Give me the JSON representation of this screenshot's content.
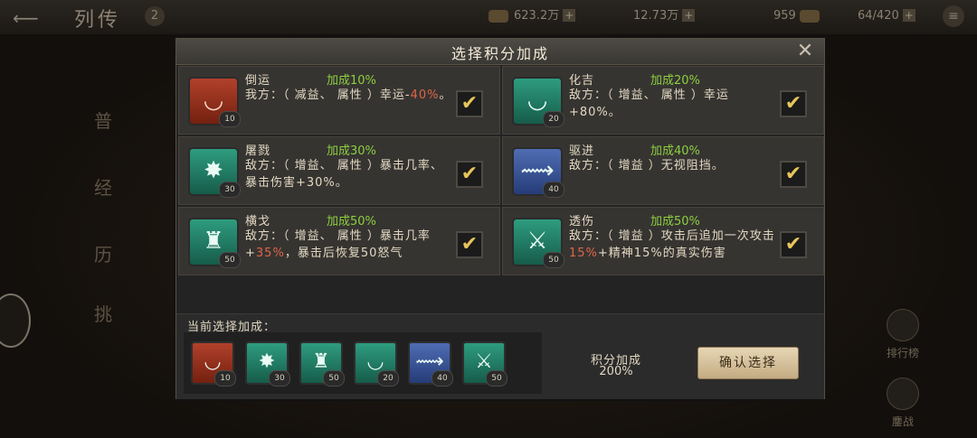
{
  "topbar": {
    "back_icon": "back-arrow",
    "page_name": "列传",
    "page_num": "2",
    "resources": [
      {
        "icon": "gold-icon",
        "value": "623.2万"
      },
      {
        "icon": "silver-icon",
        "value": "12.73万"
      },
      {
        "icon": "gem-icon",
        "value": "959"
      },
      {
        "icon": "stamina-icon",
        "value": "64/420"
      }
    ]
  },
  "left_nav": [
    "普",
    "经",
    "历",
    "挑"
  ],
  "right_buttons": [
    "排行榜",
    "鏖战"
  ],
  "modal": {
    "title": "选择积分加成",
    "cards": [
      {
        "name": "倒运",
        "bonus": "加成10%",
        "desc_pre": "我方：（ 减益、 属性 ）幸运-",
        "desc_hl": "40%",
        "desc_post": "。",
        "level": "10",
        "color": "red",
        "icon": "horn-icon",
        "checked": true
      },
      {
        "name": "化吉",
        "bonus": "加成20%",
        "desc_pre": "敌方：（ 增益、 属性 ）幸运+80%。",
        "desc_hl": "",
        "desc_post": "",
        "level": "20",
        "color": "green",
        "icon": "horn-icon",
        "checked": true
      },
      {
        "name": "屠戮",
        "bonus": "加成30%",
        "desc_pre": "敌方：（ 增益、 属性 ）暴击几率、暴击伤害+30%。",
        "desc_hl": "",
        "desc_post": "",
        "level": "30",
        "color": "green",
        "icon": "burst-icon",
        "checked": true
      },
      {
        "name": "驱进",
        "bonus": "加成40%",
        "desc_pre": "敌方：（ 增益 ）无视阻挡。",
        "desc_hl": "",
        "desc_post": "",
        "level": "40",
        "color": "blue",
        "icon": "runner-icon",
        "checked": true
      },
      {
        "name": "横戈",
        "bonus": "加成50%",
        "desc_pre": "敌方：（ 增益、 属性 ）暴击几率+",
        "desc_hl": "35%",
        "desc_post": "，暴击后恢复50怒气",
        "level": "50",
        "color": "green",
        "icon": "warrior-icon",
        "checked": true
      },
      {
        "name": "透伤",
        "bonus": "加成50%",
        "desc_pre": "敌方：（ 增益 ）攻击后追加一次攻击",
        "desc_hl": "15%",
        "desc_post": "+精神15%的真实伤害",
        "level": "50",
        "color": "green",
        "icon": "sword-icon",
        "checked": true
      }
    ],
    "current_label": "当前选择加成：",
    "selected": [
      {
        "color": "red",
        "icon": "horn-icon",
        "level": "10"
      },
      {
        "color": "green",
        "icon": "burst-icon",
        "level": "30"
      },
      {
        "color": "green",
        "icon": "warrior-icon",
        "level": "50"
      },
      {
        "color": "green",
        "icon": "horn-icon",
        "level": "20"
      },
      {
        "color": "blue",
        "icon": "runner-icon",
        "level": "40"
      },
      {
        "color": "green",
        "icon": "sword-icon",
        "level": "50"
      }
    ],
    "score_label": "积分加成",
    "score_value": "200%",
    "confirm_label": "确认选择",
    "close_icon": "close-icon"
  }
}
